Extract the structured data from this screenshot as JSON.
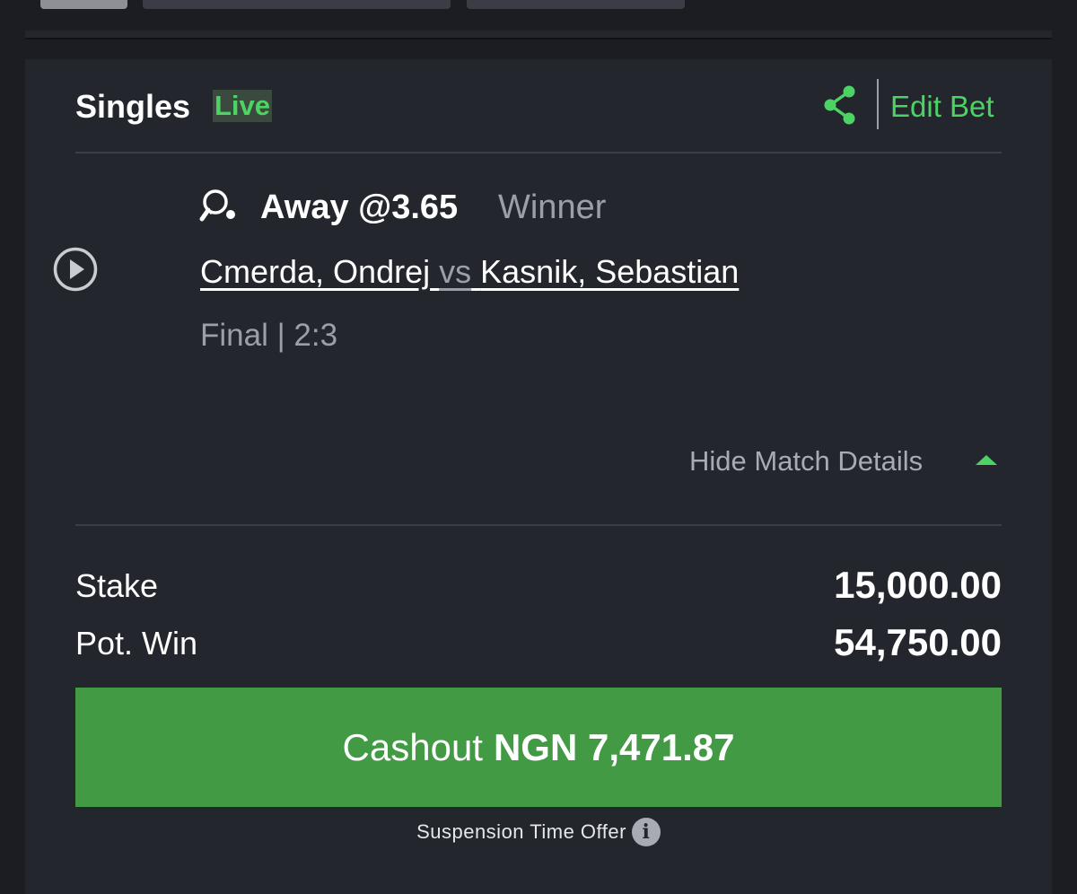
{
  "bet": {
    "type_label": "Singles",
    "live_badge": "Live",
    "edit_label": "Edit Bet",
    "selection": "Away @3.65",
    "market": "Winner",
    "home_team": "Cmerda, Ondrej",
    "vs_label": "vs",
    "away_team": "Kasnik, Sebastian",
    "status": "Final | 2:3",
    "toggle_details_label": "Hide Match Details",
    "sport_icon": "table-tennis-icon"
  },
  "summary": {
    "stake_label": "Stake",
    "stake_value": "15,000.00",
    "potwin_label": "Pot. Win",
    "potwin_value": "54,750.00"
  },
  "cashout": {
    "label": "Cashout",
    "amount": "NGN 7,471.87",
    "offer_text": "Suspension Time Offer",
    "info_glyph": "i"
  },
  "colors": {
    "accent": "#4cd364",
    "button": "#439a45",
    "card_bg": "#23262d",
    "page_bg": "#1b1d22",
    "muted_text": "#9aa0a6"
  }
}
